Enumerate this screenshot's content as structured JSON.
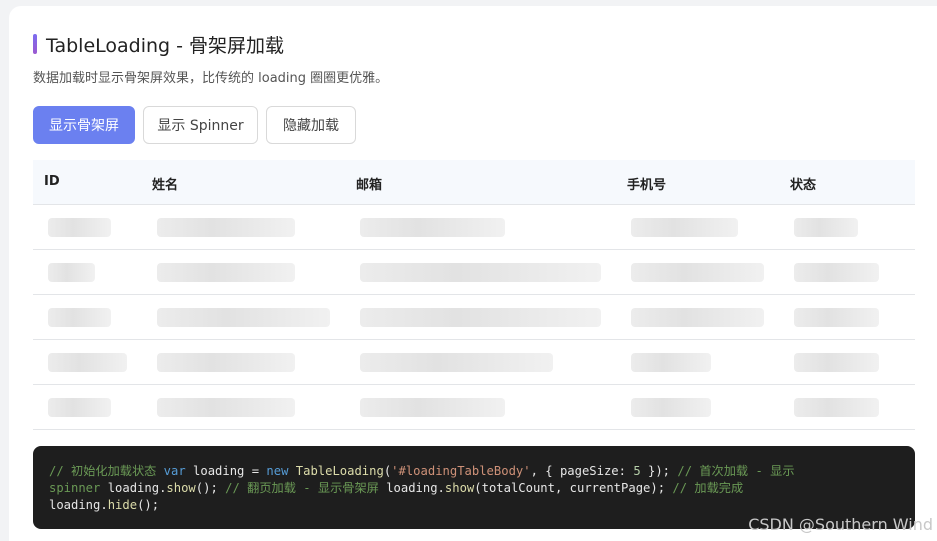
{
  "header": {
    "title": "TableLoading - 骨架屏加载",
    "subtitle": "数据加载时显示骨架屏效果，比传统的 loading 圈圈更优雅。"
  },
  "buttons": {
    "show_skeleton": "显示骨架屏",
    "show_spinner": "显示 Spinner",
    "hide_loading": "隐藏加载"
  },
  "table": {
    "columns": [
      "ID",
      "姓名",
      "邮箱",
      "手机号",
      "状态"
    ],
    "skeleton_row_count": 5
  },
  "code": {
    "line1": {
      "comment1": "// 初始化加载状态",
      "kw_var": "var",
      "ident": " loading = ",
      "kw_new": "new",
      "space": " ",
      "fn_ctor": "TableLoading",
      "paren_open": "(",
      "str_sel": "'#loadingTableBody'",
      "obj_open": ", { pageSize: ",
      "num": "5",
      "obj_close": " }); ",
      "comment2": "// 首次加载 - 显示"
    },
    "line2": {
      "comment_tail": "spinner",
      "stmt1": " loading.",
      "fn_show1": "show",
      "call1": "(); ",
      "comment3": "// 翻页加载 - 显示骨架屏",
      "stmt2": " loading.",
      "fn_show2": "show",
      "args": "(totalCount, currentPage); ",
      "comment4": "// 加载完成"
    },
    "line3": {
      "stmt": "loading.",
      "fn_hide": "hide",
      "call": "();"
    }
  },
  "watermark": "CSDN @Southern Wind"
}
